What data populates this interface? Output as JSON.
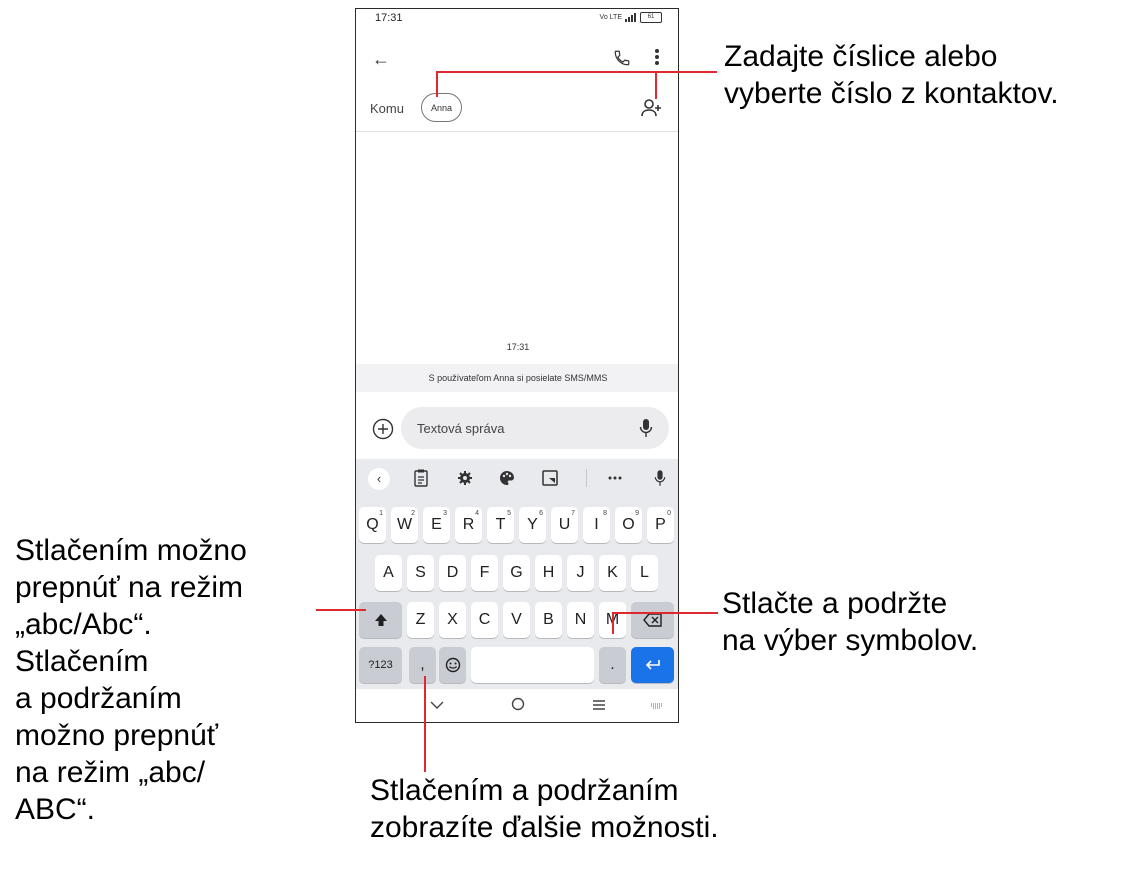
{
  "status": {
    "time": "17:31",
    "network": "Vo LTE",
    "battery": "61"
  },
  "compose": {
    "to_label": "Komu",
    "recipient_chip": "Anna",
    "timestamp": "17:31",
    "sms_note": "S používateľom Anna si posielate SMS/MMS",
    "input_placeholder": "Textová správa"
  },
  "keyboard": {
    "toolbar_icons": [
      "chevron-left-icon",
      "clipboard-icon",
      "gear-icon",
      "palette-icon",
      "floating-keyboard-icon",
      "more-icon",
      "mic-icon"
    ],
    "row1": [
      {
        "key": "Q",
        "num": "1"
      },
      {
        "key": "W",
        "num": "2"
      },
      {
        "key": "E",
        "num": "3"
      },
      {
        "key": "R",
        "num": "4"
      },
      {
        "key": "T",
        "num": "5"
      },
      {
        "key": "Y",
        "num": "6"
      },
      {
        "key": "U",
        "num": "7"
      },
      {
        "key": "I",
        "num": "8"
      },
      {
        "key": "O",
        "num": "9"
      },
      {
        "key": "P",
        "num": "0"
      }
    ],
    "row2": [
      "A",
      "S",
      "D",
      "F",
      "G",
      "H",
      "J",
      "K",
      "L"
    ],
    "row3": [
      "Z",
      "X",
      "C",
      "V",
      "B",
      "N",
      "M"
    ],
    "symbols_key": "?123",
    "comma_key": ",",
    "period_key": "."
  },
  "callouts": {
    "top_right": [
      "Zadajte číslice alebo",
      "vyberte číslo z kontaktov."
    ],
    "left": [
      "Stlačením možno",
      "prepnúť na režim",
      "„abc/Abc“.",
      "Stlačením",
      "a podržaním",
      "možno prepnúť",
      "na režim „abc/",
      "ABC“."
    ],
    "right": [
      "Stlačte a podržte",
      "na výber symbolov."
    ],
    "bottom": [
      "Stlačením a podržaním",
      "zobrazíte ďalšie možnosti."
    ]
  },
  "colors": {
    "callout_line": "#e0282f",
    "enter_key": "#1a73e8",
    "keyboard_bg": "#e8eaed"
  }
}
